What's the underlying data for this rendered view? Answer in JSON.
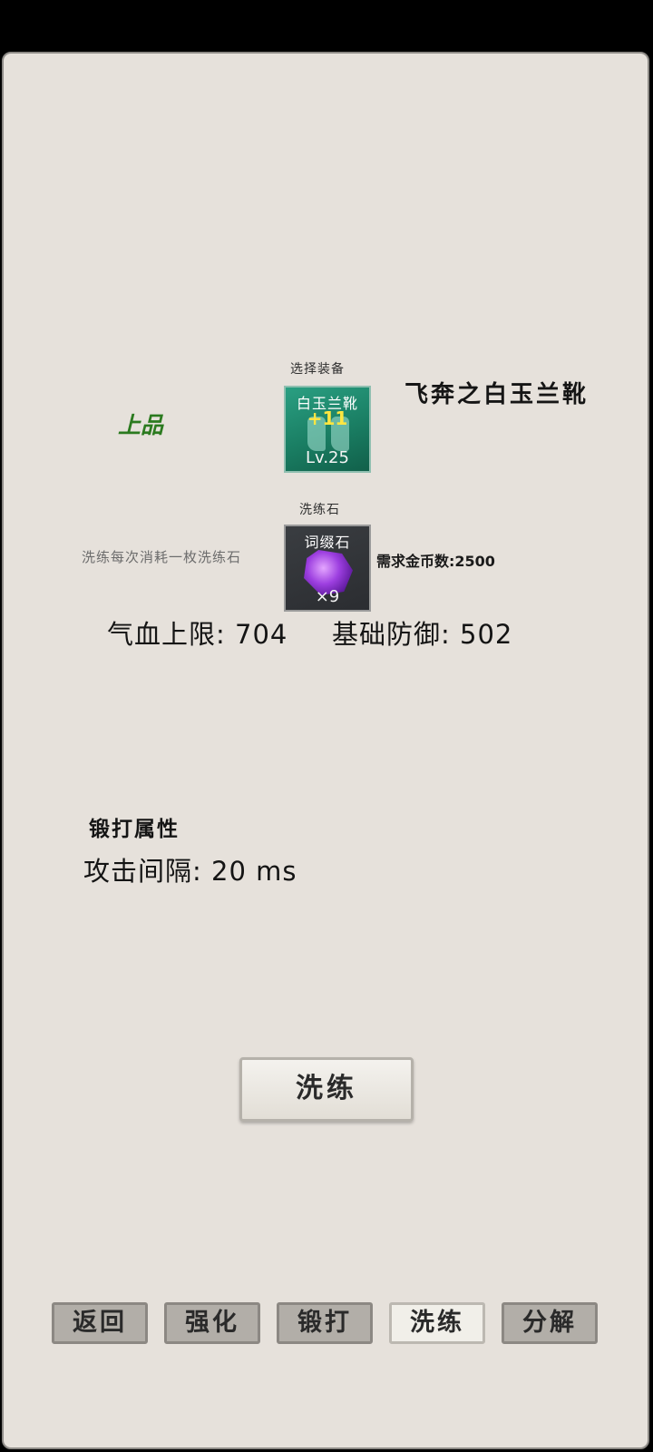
{
  "equip_section": {
    "select_label": "选择装备",
    "quality": "上品",
    "equip_name": "飞奔之白玉兰靴",
    "slot": {
      "name": "白玉兰靴",
      "plus": "+11",
      "level": "Lv.25"
    }
  },
  "stone_section": {
    "label": "洗练石",
    "note": "洗练每次消耗一枚洗练石",
    "slot": {
      "name": "词缀石",
      "count": "×9"
    },
    "cost": "需求金币数:2500"
  },
  "stats": {
    "hp": "气血上限: 704",
    "defense": "基础防御: 502"
  },
  "forge": {
    "title": "锻打属性",
    "attr": "攻击间隔: 20 ms"
  },
  "action": {
    "refine_label": "洗练"
  },
  "tabs": [
    {
      "label": "返回",
      "active": false
    },
    {
      "label": "强化",
      "active": false
    },
    {
      "label": "锻打",
      "active": false
    },
    {
      "label": "洗练",
      "active": true
    },
    {
      "label": "分解",
      "active": false
    }
  ],
  "colors": {
    "panel_bg": "#e6e1db",
    "quality_green": "#2b7a1f",
    "plus_yellow": "#ffe640"
  }
}
